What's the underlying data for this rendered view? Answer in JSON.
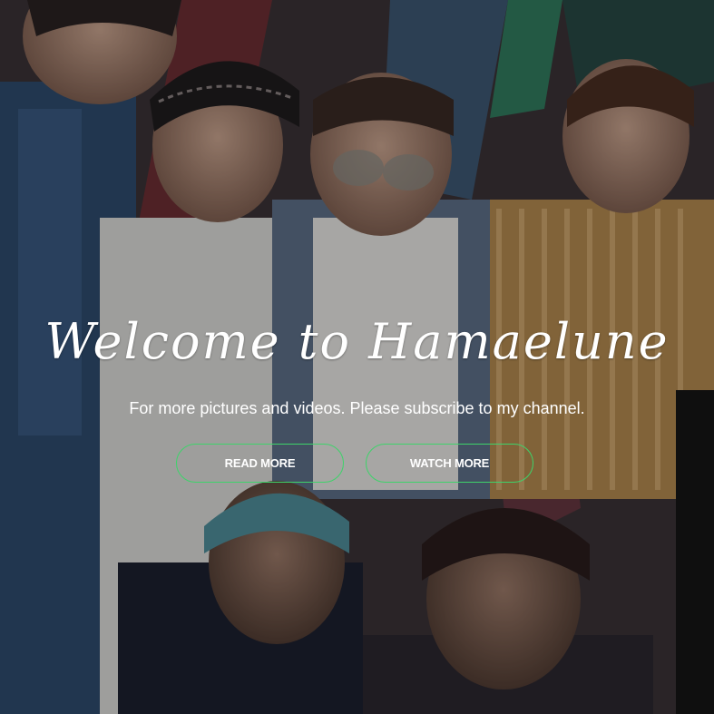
{
  "hero": {
    "title": "Welcome to Hamaelune",
    "subtitle": "For more pictures and videos. Please subscribe to my channel.",
    "buttons": {
      "read_more": "READ MORE",
      "watch_more": "WATCH MORE"
    },
    "colors": {
      "button_border": "#3ed36a",
      "text": "#ffffff"
    },
    "background": "group-photo"
  }
}
